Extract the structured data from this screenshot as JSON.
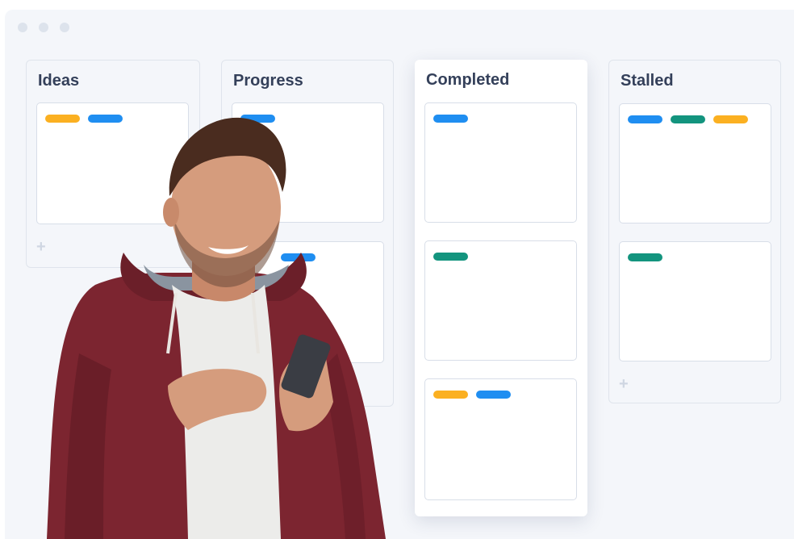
{
  "colors": {
    "yellow": "#fbb021",
    "blue": "#1f8ef1",
    "teal": "#13947e",
    "background": "#f4f6fa"
  },
  "board": {
    "columns": [
      {
        "title": "Ideas",
        "add_label": "+",
        "cards": [
          {
            "tags": [
              "yellow",
              "blue"
            ]
          }
        ]
      },
      {
        "title": "Progress",
        "cards": [
          {
            "tags": [
              "blue"
            ]
          },
          {
            "tags": [
              "blue"
            ]
          }
        ]
      },
      {
        "title": "Completed",
        "cards": [
          {
            "tags": [
              "blue"
            ]
          },
          {
            "tags": [
              "teal"
            ]
          },
          {
            "tags": [
              "yellow",
              "blue"
            ]
          }
        ]
      },
      {
        "title": "Stalled",
        "add_label": "+",
        "cards": [
          {
            "tags": [
              "blue",
              "teal",
              "yellow"
            ]
          },
          {
            "tags": [
              "teal"
            ]
          }
        ]
      }
    ]
  }
}
